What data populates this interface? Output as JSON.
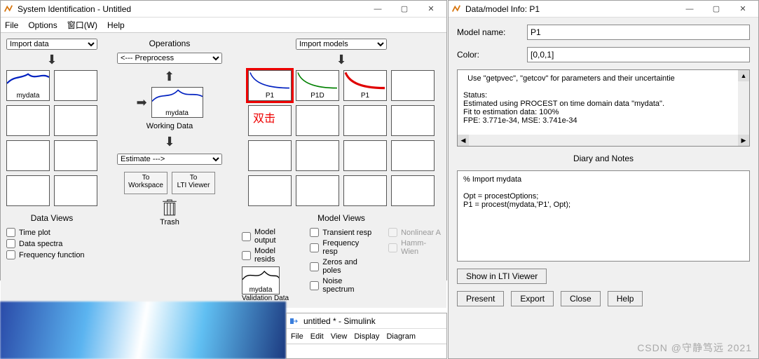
{
  "sysid": {
    "title": "System Identification - Untitled",
    "menu": {
      "file": "File",
      "options": "Options",
      "window": "窗口(W)",
      "help": "Help"
    },
    "import_data": "Import data",
    "import_models": "Import models",
    "ops_title": "Operations",
    "preprocess": "<--- Preprocess",
    "working_data": "Working Data",
    "estimate": "Estimate --->",
    "to_workspace": "To\nWorkspace",
    "to_lti": "To\nLTI Viewer",
    "trash": "Trash",
    "data_views_title": "Data Views",
    "model_views_title": "Model Views",
    "data_left": {
      "mydata": "mydata"
    },
    "models": {
      "p1": "P1",
      "p1d": "P1D",
      "p1b": "P1"
    },
    "red_note": "双击",
    "validation_data": "Validation Data",
    "views": {
      "time_plot": "Time plot",
      "data_spectra": "Data spectra",
      "freq_func": "Frequency function",
      "model_output": "Model output",
      "model_resids": "Model resids",
      "transient": "Transient resp",
      "freq_resp": "Frequency resp",
      "zeros": "Zeros and poles",
      "noise": "Noise spectrum",
      "nonlinear": "Nonlinear A",
      "hamm": "Hamm-Wien"
    },
    "working_thumb": "mydata",
    "validation_thumb": "mydata"
  },
  "info": {
    "title": "Data/model Info: P1",
    "model_name_label": "Model name:",
    "model_name_value": "P1",
    "color_label": "Color:",
    "color_value": "[0,0,1]",
    "status_lines": {
      "l1": "  Use \"getpvec\", \"getcov\" for parameters and their uncertaintie",
      "l2": "Status:",
      "l3": "Estimated using PROCEST on time domain data \"mydata\".",
      "l4": "Fit to estimation data: 100%",
      "l5": "FPE: 3.771e-34, MSE: 3.741e-34"
    },
    "diary_title": "Diary and Notes",
    "diary_lines": {
      "l1": "% Import   mydata",
      "l2": "Opt = procestOptions;",
      "l3": "P1 = procest(mydata,'P1', Opt);"
    },
    "show_lti": "Show in LTI Viewer",
    "present": "Present",
    "export": "Export",
    "close": "Close",
    "help": "Help"
  },
  "simulink": {
    "title": "untitled * - Simulink",
    "menu": {
      "file": "File",
      "edit": "Edit",
      "view": "View",
      "display": "Display",
      "diagram": "Diagram"
    }
  },
  "watermark": "CSDN @守静笃远 2021"
}
